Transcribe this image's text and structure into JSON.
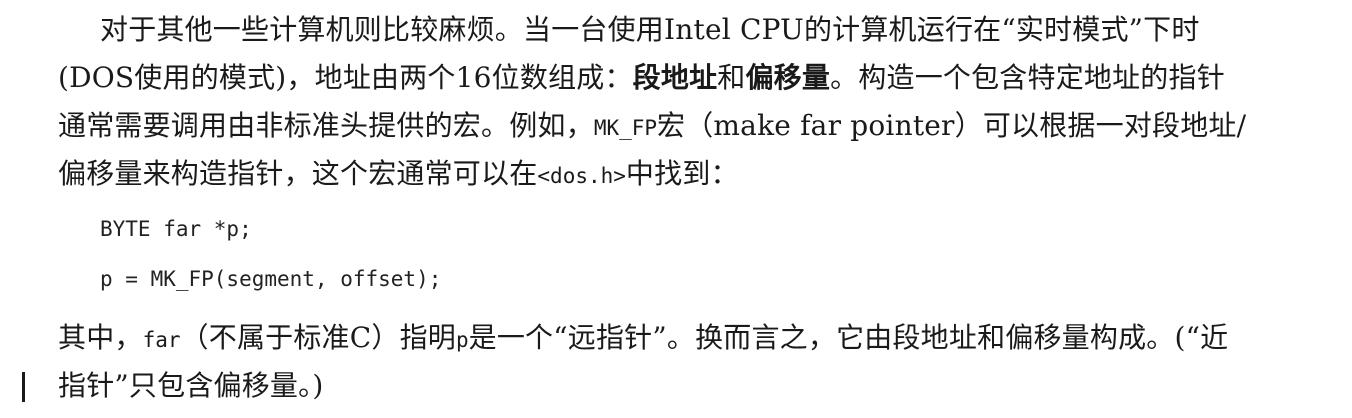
{
  "paragraph1": {
    "line1": "对于其他一些计算机则比较麻烦。当一台使用Intel CPU的计算机运行在“实时模式”下时",
    "line2_a": "(DOS使用的模式)，地址由两个16位数组成：",
    "line2_bold1": "段地址",
    "line2_b": "和",
    "line2_bold2": "偏移量",
    "line2_c": "。构造一个包含特定地址的指针",
    "line3_a": "通常需要调用由非标准头提供的宏。例如，",
    "line3_code": "MK_FP",
    "line3_b": "宏（make far pointer）可以根据一对段地址/",
    "line4_a": "偏移量来构造指针，这个宏通常可以在",
    "line4_code": "<dos.h>",
    "line4_b": "中找到："
  },
  "code": [
    "BYTE far *p;",
    "p = MK_FP(segment, offset);"
  ],
  "paragraph2": {
    "line1_a": "其中，",
    "line1_code1": "far",
    "line1_b": "（不属于标准C）指明",
    "line1_code2": "p",
    "line1_c": "是一个“远指针”。换而言之，它由段地址和偏移量构成。(“近",
    "line2": "指针”只包含偏移量。)"
  }
}
